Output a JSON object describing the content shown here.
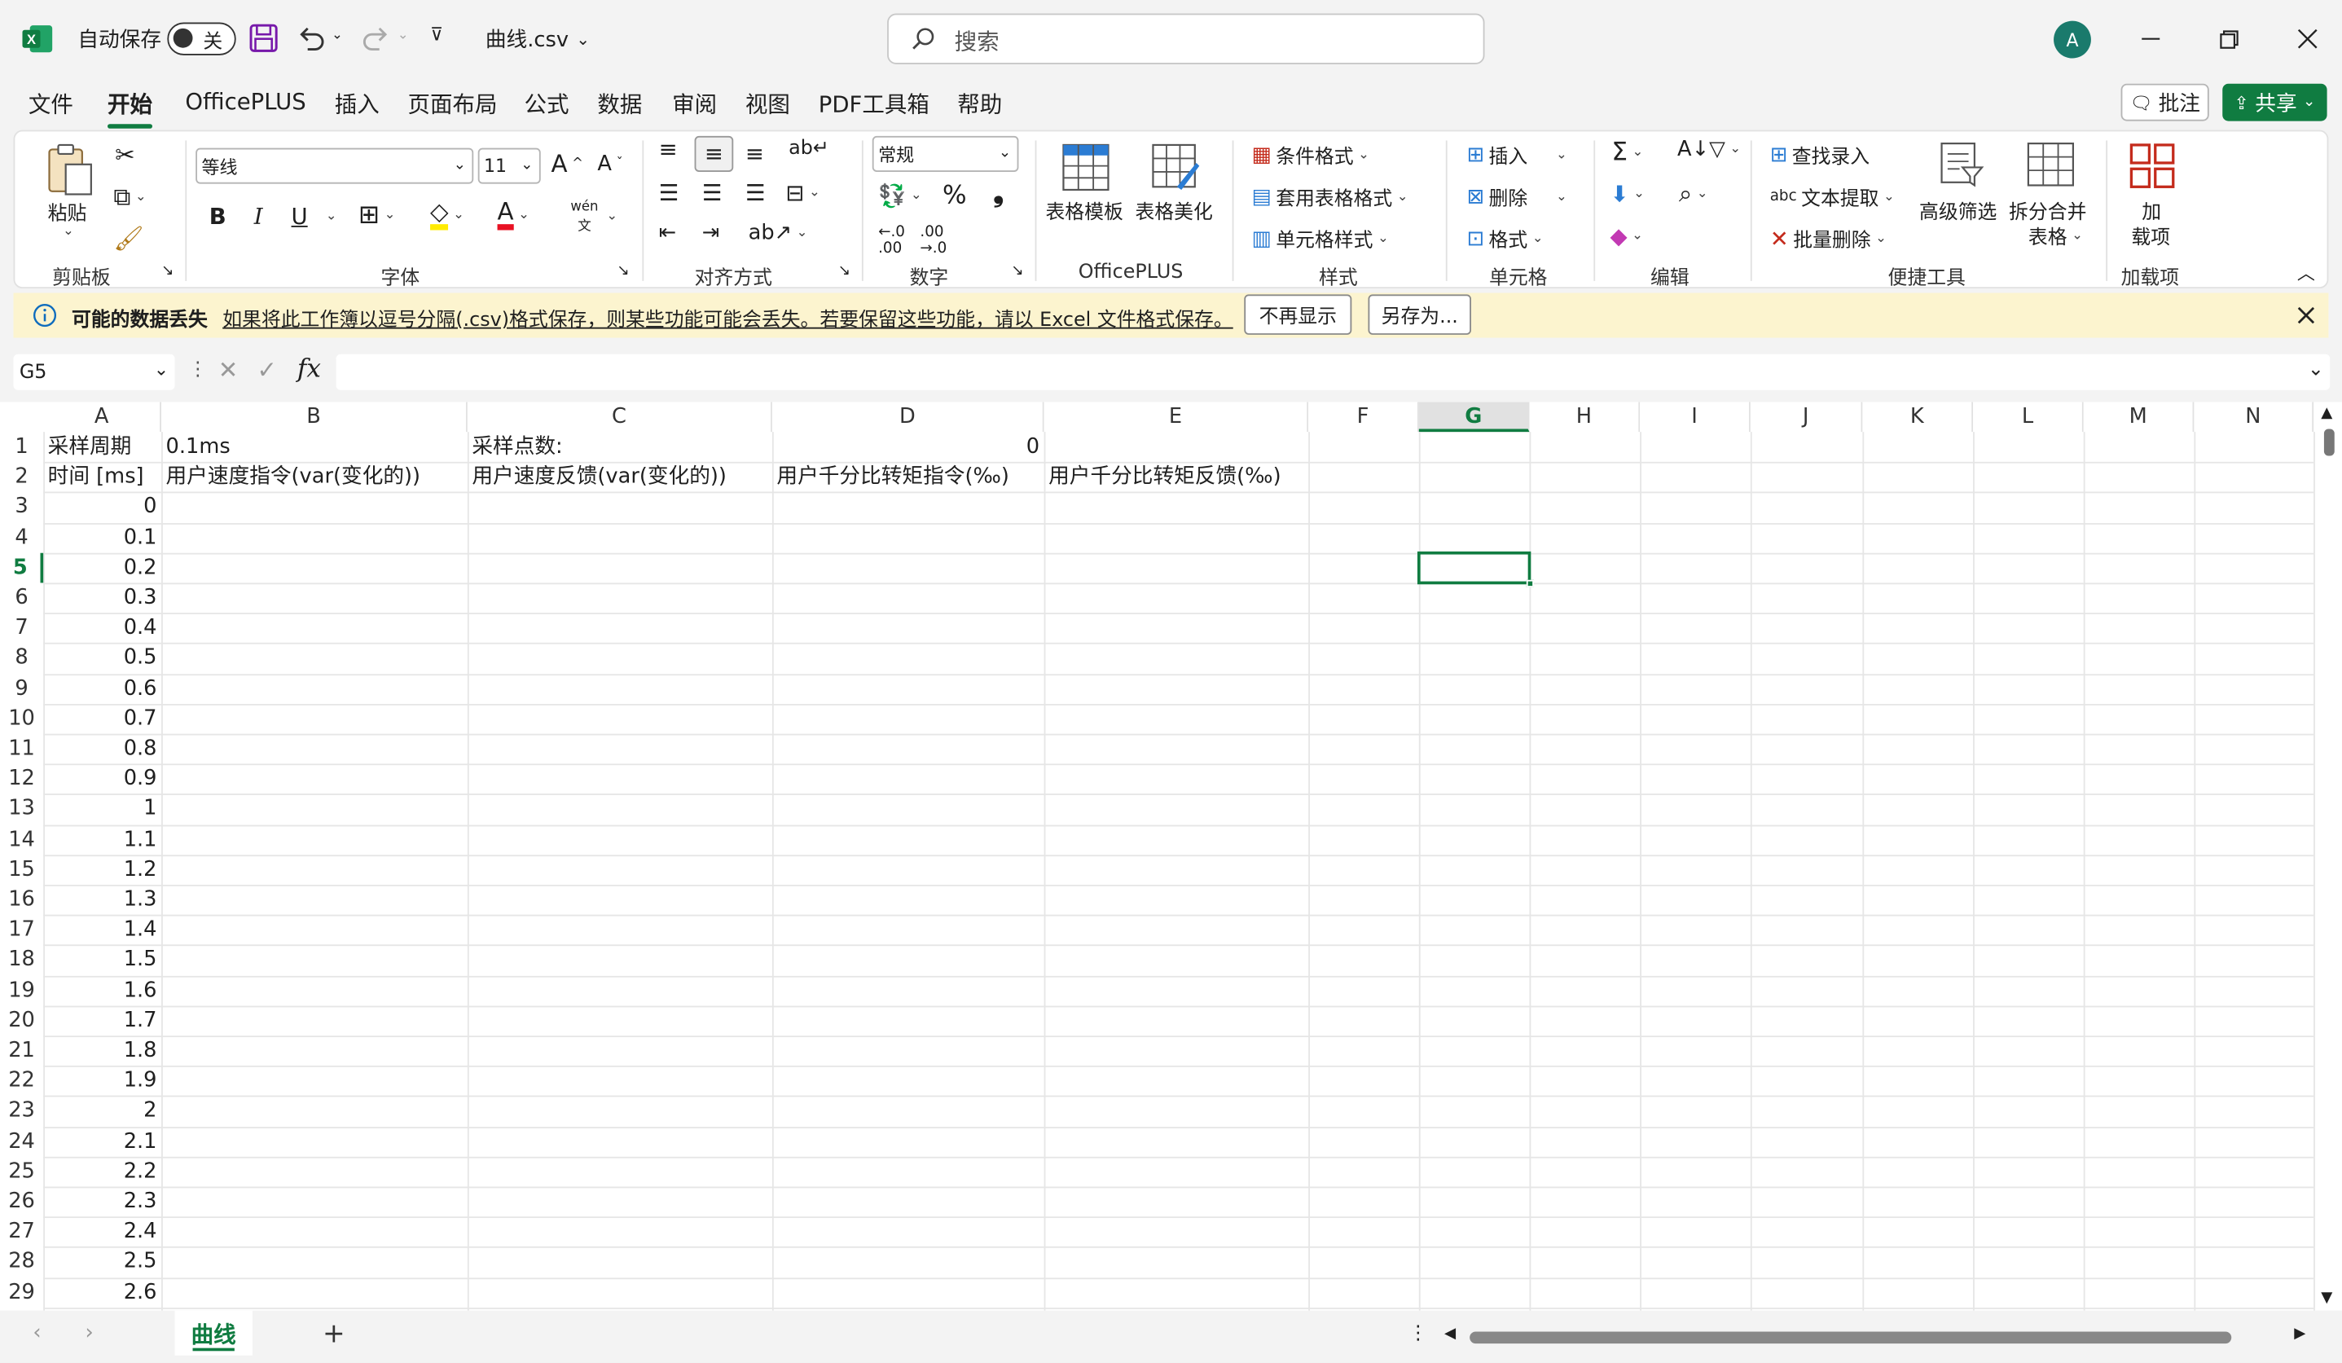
{
  "titlebar": {
    "autosave_label": "自动保存",
    "autosave_state": "关",
    "filename": "曲线.csv",
    "search_placeholder": "搜索",
    "avatar_initial": "A"
  },
  "menu": [
    "文件",
    "开始",
    "OfficePLUS",
    "插入",
    "页面布局",
    "公式",
    "数据",
    "审阅",
    "视图",
    "PDF工具箱",
    "帮助"
  ],
  "menu_active": "开始",
  "comment_label": "批注",
  "share_label": "共享",
  "ribbon": {
    "clipboard": {
      "paste": "粘贴",
      "group": "剪贴板"
    },
    "font": {
      "name": "等线",
      "size": "11",
      "bold": "B",
      "italic": "I",
      "underline": "U",
      "pinyin": "wén",
      "group": "字体"
    },
    "align": {
      "group": "对齐方式"
    },
    "number": {
      "format": "常规",
      "group": "数字"
    },
    "officeplus": {
      "template": "表格模板",
      "beautify": "表格美化",
      "group": "OfficePLUS"
    },
    "styles": {
      "conditional": "条件格式",
      "table_format": "套用表格格式",
      "cell_style": "单元格样式",
      "group": "样式"
    },
    "cells": {
      "insert": "插入",
      "delete": "删除",
      "format": "格式",
      "group": "单元格"
    },
    "editing": {
      "group": "编辑"
    },
    "tools": {
      "find": "查找录入",
      "extract": "文本提取",
      "bulk_delete": "批量删除",
      "filter": "高级筛选",
      "split": "拆分合并",
      "split2": "表格",
      "group": "便捷工具"
    },
    "addins": {
      "label1": "加",
      "label2": "载项",
      "group": "加载项"
    }
  },
  "infobar": {
    "title": "可能的数据丢失",
    "message": "如果将此工作簿以逗号分隔(.csv)格式保存，则某些功能可能会丢失。若要保留这些功能，请以 Excel 文件格式保存。",
    "btn_dismiss": "不再显示",
    "btn_saveas": "另存为..."
  },
  "formula": {
    "namebox": "G5",
    "fx": "fx",
    "value": ""
  },
  "columns": [
    "A",
    "B",
    "C",
    "D",
    "E",
    "F",
    "G",
    "H",
    "I",
    "J",
    "K",
    "L",
    "M",
    "N"
  ],
  "rows": [
    {
      "n": "1",
      "A": "采样周期",
      "B": "0.1ms",
      "C": "采样点数:",
      "D": "0",
      "E": ""
    },
    {
      "n": "2",
      "A": "时间 [ms]",
      "B": "用户速度指令(var(变化的))",
      "C": "用户速度反馈(var(变化的))",
      "D": "用户千分比转矩指令(‰)",
      "E": "用户千分比转矩反馈(‰)"
    },
    {
      "n": "3",
      "A": "0"
    },
    {
      "n": "4",
      "A": "0.1"
    },
    {
      "n": "5",
      "A": "0.2"
    },
    {
      "n": "6",
      "A": "0.3"
    },
    {
      "n": "7",
      "A": "0.4"
    },
    {
      "n": "8",
      "A": "0.5"
    },
    {
      "n": "9",
      "A": "0.6"
    },
    {
      "n": "10",
      "A": "0.7"
    },
    {
      "n": "11",
      "A": "0.8"
    },
    {
      "n": "12",
      "A": "0.9"
    },
    {
      "n": "13",
      "A": "1"
    },
    {
      "n": "14",
      "A": "1.1"
    },
    {
      "n": "15",
      "A": "1.2"
    },
    {
      "n": "16",
      "A": "1.3"
    },
    {
      "n": "17",
      "A": "1.4"
    },
    {
      "n": "18",
      "A": "1.5"
    },
    {
      "n": "19",
      "A": "1.6"
    },
    {
      "n": "20",
      "A": "1.7"
    },
    {
      "n": "21",
      "A": "1.8"
    },
    {
      "n": "22",
      "A": "1.9"
    },
    {
      "n": "23",
      "A": "2"
    },
    {
      "n": "24",
      "A": "2.1"
    },
    {
      "n": "25",
      "A": "2.2"
    },
    {
      "n": "26",
      "A": "2.3"
    },
    {
      "n": "27",
      "A": "2.4"
    },
    {
      "n": "28",
      "A": "2.5"
    },
    {
      "n": "29",
      "A": "2.6"
    }
  ],
  "sheet_tab": "曲线",
  "accent": "#107c41"
}
